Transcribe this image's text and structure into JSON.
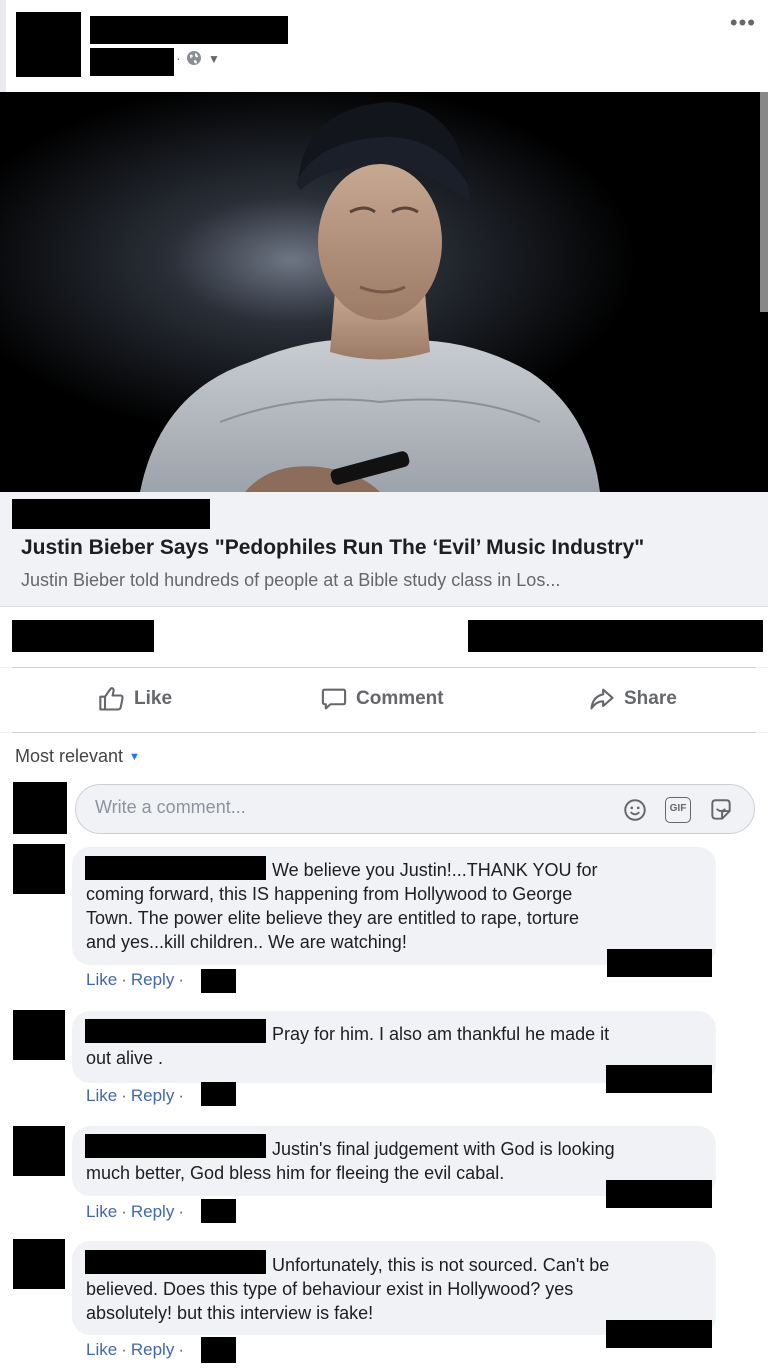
{
  "post": {
    "menu": "•••",
    "link": {
      "title": "Justin Bieber Says \"Pedophiles Run The ‘Evil’ Music Industry\"",
      "description": "Justin Bieber told hundreds of people at a Bible study class in Los..."
    }
  },
  "actions": {
    "like": "Like",
    "comment": "Comment",
    "share": "Share"
  },
  "comments_section": {
    "sort_label": "Most relevant",
    "write_placeholder": "Write a comment...",
    "gif_label": "GIF"
  },
  "comments": [
    {
      "lines": [
        "We believe you Justin!...THANK YOU for",
        "coming forward, this IS happening from Hollywood to George",
        "Town. The power elite believe they are entitled to rape, torture",
        "and yes...kill children.. We are watching!"
      ],
      "like": "Like",
      "reply": "Reply"
    },
    {
      "lines": [
        "Pray for him. I also am thankful he made it",
        "out alive ."
      ],
      "like": "Like",
      "reply": "Reply"
    },
    {
      "lines": [
        "Justin's final judgement with God is looking",
        "much better, God bless him for fleeing the evil cabal."
      ],
      "like": "Like",
      "reply": "Reply"
    },
    {
      "lines": [
        "Unfortunately, this is not sourced. Can't be",
        "believed. Does this type of behaviour exist in Hollywood? yes",
        "absolutely! but this interview is fake!"
      ],
      "like": "Like",
      "reply": "Reply"
    }
  ],
  "colors": {
    "link_blue": "#4267b2",
    "accent_blue": "#1877f2",
    "muted_text": "#65676b",
    "bubble_bg": "#f0f2f5"
  },
  "icons": [
    "globe-icon",
    "chevron-down-icon",
    "thumbs-up-icon",
    "comment-icon",
    "share-arrow-icon",
    "emoji-icon",
    "gif-icon",
    "sticker-icon"
  ]
}
